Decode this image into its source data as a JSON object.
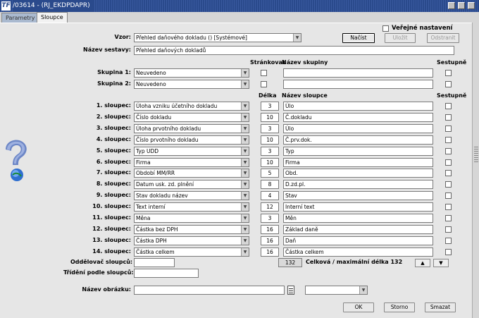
{
  "window": {
    "title": "/03614 - (RJ_EKDPDAPR)",
    "app_icon": "TF"
  },
  "tabs": [
    {
      "label": "Parametry",
      "active": false
    },
    {
      "label": "Sloupce",
      "active": true
    }
  ],
  "header": {
    "public_settings_label": "Veřejné nastavení",
    "vzor_label": "Vzor:",
    "vzor_value": "Přehled daňového dokladu   ()   [Systémové]",
    "nazev_sestavy_label": "Název sestavy:",
    "nazev_sestavy_value": "Přehled daňových dokladů",
    "load_button": "Načíst",
    "save_button": "Uložit",
    "delete_button": "Odstranit"
  },
  "groups": {
    "col_paging": "Stránkovat",
    "col_group_name": "Název skupiny",
    "col_desc": "Sestupně",
    "rows": [
      {
        "label": "Skupina 1:",
        "value": "Neuvedeno",
        "name": ""
      },
      {
        "label": "Skupina 2:",
        "value": "Neuvedeno",
        "name": ""
      }
    ]
  },
  "columns": {
    "col_length": "Délka",
    "col_name": "Název sloupce",
    "col_desc": "Sestupně",
    "rows": [
      {
        "label": "1. sloupec:",
        "value": "Úloha vzniku účetního dokladu",
        "length": "3",
        "name": "Úlo"
      },
      {
        "label": "2. sloupec:",
        "value": "Číslo dokladu",
        "length": "10",
        "name": "Č.dokladu"
      },
      {
        "label": "3. sloupec:",
        "value": "Úloha prvotního dokladu",
        "length": "3",
        "name": "Úlo"
      },
      {
        "label": "4. sloupec:",
        "value": "Číslo prvotního dokladu",
        "length": "10",
        "name": "Č.prv.dok."
      },
      {
        "label": "5. sloupec:",
        "value": "Typ UDD",
        "length": "3",
        "name": "Typ"
      },
      {
        "label": "6. sloupec:",
        "value": "Firma",
        "length": "10",
        "name": "Firma"
      },
      {
        "label": "7. sloupec:",
        "value": "Období MM/RR",
        "length": "5",
        "name": "Obd."
      },
      {
        "label": "8. sloupec:",
        "value": "Datum usk. zd. plnění",
        "length": "8",
        "name": "D.zd.pl."
      },
      {
        "label": "9. sloupec:",
        "value": "Stav dokladu název",
        "length": "4",
        "name": "Stav"
      },
      {
        "label": "10. sloupec:",
        "value": "Text interní",
        "length": "12",
        "name": "Interní text"
      },
      {
        "label": "11. sloupec:",
        "value": "Měna",
        "length": "3",
        "name": "Měn"
      },
      {
        "label": "12. sloupec:",
        "value": "Částka bez DPH",
        "length": "16",
        "name": "Základ daně"
      },
      {
        "label": "13. sloupec:",
        "value": "Částka DPH",
        "length": "16",
        "name": "Daň"
      },
      {
        "label": "14. sloupec:",
        "value": "Částka celkem",
        "length": "16",
        "name": "Částka celkem"
      }
    ]
  },
  "footer": {
    "separator_label": "Oddělovač sloupců:",
    "separator_value": "",
    "total_length": "132",
    "total_label": "Celková / maximální délka 132",
    "sort_label": "Třídění podle sloupců:",
    "sort_value": "",
    "image_label": "Název obrázku:",
    "image_value": "",
    "image_combo_value": "",
    "ok_button": "OK",
    "cancel_button": "Storno",
    "clear_button": "Smazat",
    "up_arrow": "▲",
    "down_arrow": "▼"
  }
}
